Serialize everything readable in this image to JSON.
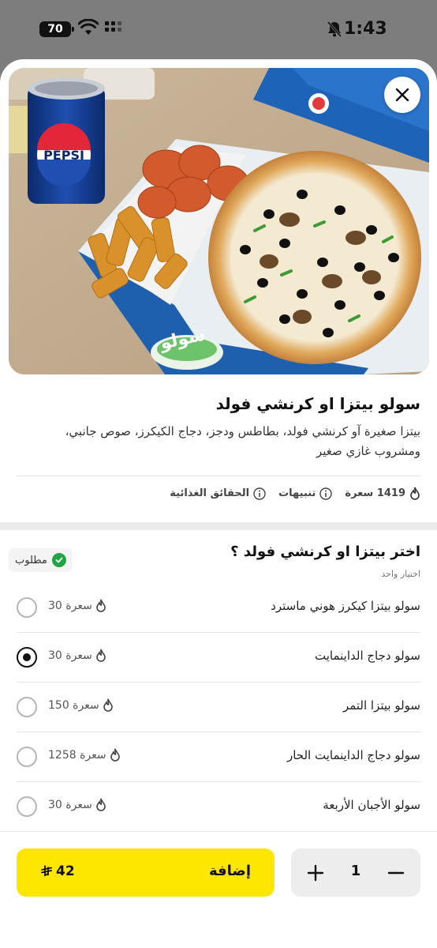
{
  "status_bar": {
    "battery": "70",
    "time": "1:43"
  },
  "hero": {
    "image": "pizza-and-crunchy-fold-meal-photo",
    "close_icon": "close-icon",
    "can_label": "PEPSI",
    "box_text": "سولو"
  },
  "product": {
    "title": "سولو بيتزا او كرنشي فولد",
    "description": "بيتزا صغيرة آو كرنشي فولد، بطاطس ودجز، دجاج الكيكرز، صوص جانبي، ومشروب غازي صغير",
    "calories": "1419 سعرة",
    "alerts": "تنبيهات",
    "nutrition": "الحقائق الغذائية"
  },
  "section": {
    "title": "اختر بيتزا او كرنشي فولد ؟",
    "subtitle": "اختيار واحد",
    "required": "مطلوب"
  },
  "options": [
    {
      "name": "سولو بيتزا كيكرز هوني ماسترد",
      "calories": "30 سعرة",
      "selected": false
    },
    {
      "name": "سولو دجاج الداينمايت",
      "calories": "30 سعرة",
      "selected": true
    },
    {
      "name": "سولو بيتزا التمر",
      "calories": "150 سعرة",
      "selected": false
    },
    {
      "name": "سولو دجاج الداينمايت الحار",
      "calories": "1258 سعرة",
      "selected": false
    },
    {
      "name": "سولو الأجبان الأربعة",
      "calories": "30 سعرة",
      "selected": false
    }
  ],
  "cart": {
    "add_label": "إضافة",
    "price": "42",
    "quantity": "1"
  },
  "colors": {
    "accent": "#fde600",
    "check": "#20a542",
    "sheet_bg": "#ffffff",
    "backdrop": "#7d7d7d"
  }
}
